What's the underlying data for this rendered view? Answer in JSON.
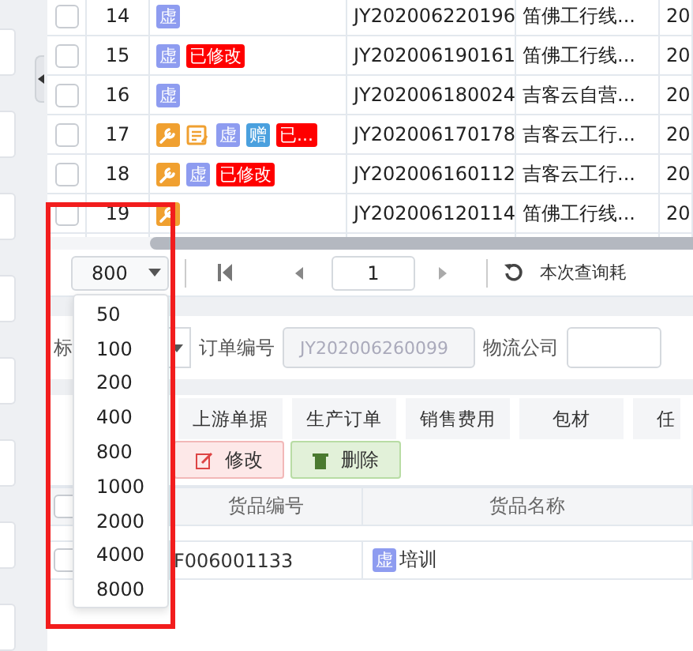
{
  "top_table": {
    "rows": [
      {
        "checked": false,
        "number": "14",
        "tags": [
          {
            "kind": "virtual",
            "text": "虚"
          }
        ],
        "order_no": "JY202006220196",
        "company": "笛佛工行线...",
        "column_5": "20"
      },
      {
        "checked": false,
        "number": "15",
        "tags": [
          {
            "kind": "virtual",
            "text": "虚"
          },
          {
            "kind": "modified",
            "text": "已修改"
          }
        ],
        "order_no": "JY202006190161",
        "company": "笛佛工行线...",
        "column_5": "20"
      },
      {
        "checked": false,
        "number": "16",
        "tags": [
          {
            "kind": "virtual",
            "text": "虚"
          }
        ],
        "order_no": "JY202006180024",
        "company": "吉客云自营...",
        "column_5": "20"
      },
      {
        "checked": false,
        "number": "17",
        "tags": [
          {
            "kind": "wrench"
          },
          {
            "kind": "note"
          },
          {
            "kind": "virtual",
            "text": "虚"
          },
          {
            "kind": "gift",
            "text": "赠"
          },
          {
            "kind": "modified",
            "text": "已..."
          }
        ],
        "order_no": "JY202006170178",
        "company": "吉客云工行...",
        "column_5": "20"
      },
      {
        "checked": false,
        "number": "18",
        "tags": [
          {
            "kind": "wrench"
          },
          {
            "kind": "virtual",
            "text": "虚"
          },
          {
            "kind": "modified",
            "text": "已修改"
          }
        ],
        "order_no": "JY202006160112",
        "company": "吉客云工行...",
        "column_5": "20"
      },
      {
        "checked": false,
        "number": "19",
        "tags": [
          {
            "kind": "wrench"
          }
        ],
        "order_no": "JY202006120114",
        "company": "笛佛工行线...",
        "column_5": "20"
      }
    ]
  },
  "pager": {
    "page_size": "800",
    "page": "1",
    "status": "本次查询耗"
  },
  "page_size_menu": {
    "options": [
      "50",
      "100",
      "200",
      "400",
      "800",
      "1000",
      "2000",
      "4000",
      "8000"
    ]
  },
  "form": {
    "label_1": "标",
    "order_label": "订单编号",
    "order_value": "JY202006260099",
    "logistics_label": "物流公司"
  },
  "tabs": [
    {
      "label": "上游单据"
    },
    {
      "label": "生产订单"
    },
    {
      "label": "销售费用"
    },
    {
      "label": "包材"
    },
    {
      "label": "任"
    }
  ],
  "actions": [
    {
      "kind": "edit",
      "label": "修改"
    },
    {
      "kind": "delete",
      "label": "删除"
    }
  ],
  "detail_table": {
    "header_checked": false,
    "columns": [
      "货品编号",
      "货品名称"
    ],
    "rows": [
      {
        "checked": false,
        "code": "F006001133",
        "tag": "虚",
        "name": "培训"
      }
    ]
  }
}
